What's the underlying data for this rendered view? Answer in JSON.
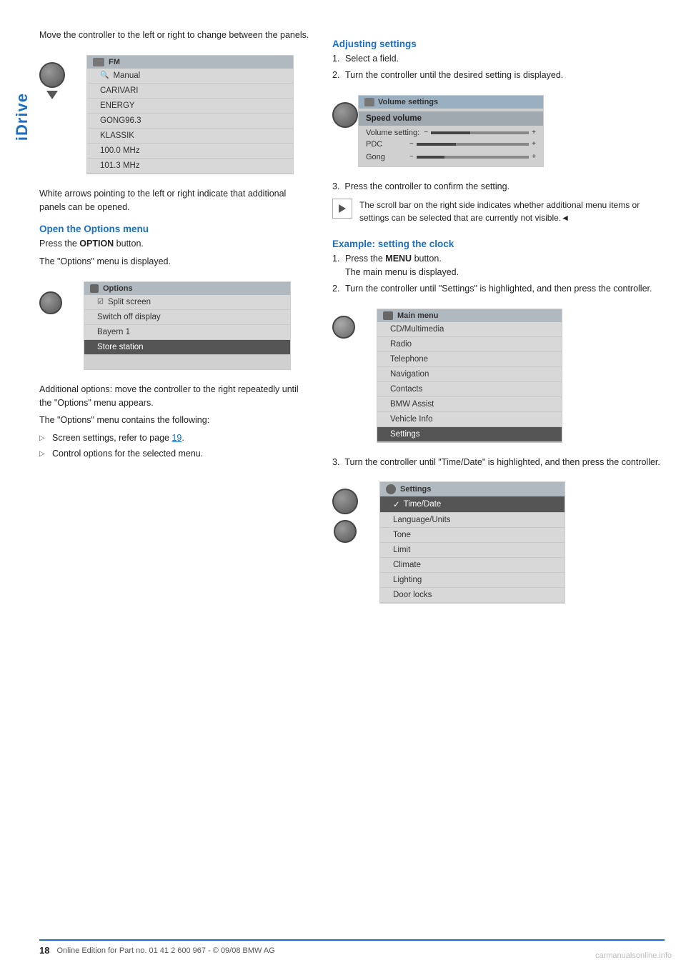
{
  "sidebar": {
    "label": "iDrive"
  },
  "left_col": {
    "intro_text": "Move the controller to the left or right to change between the panels.",
    "fm_screen": {
      "title": "FM",
      "icon": "radio-icon",
      "rows": [
        {
          "text": "Manual",
          "type": "manual"
        },
        {
          "text": "CARIVARI",
          "type": "normal"
        },
        {
          "text": "ENERGY",
          "type": "normal"
        },
        {
          "text": "GONG96.3",
          "type": "normal"
        },
        {
          "text": "KLASSIK",
          "type": "normal"
        },
        {
          "text": "100.0 MHz",
          "type": "normal"
        },
        {
          "text": "101.3 MHz",
          "type": "normal"
        }
      ]
    },
    "white_arrows_text": "White arrows pointing to the left or right indicate that additional panels can be opened.",
    "open_options_heading": "Open the Options menu",
    "open_options_p1": "Press the OPTION button.",
    "open_options_p2": "The \"Options\" menu is displayed.",
    "options_screen": {
      "title": "Options",
      "rows": [
        {
          "text": "Split screen",
          "type": "checked"
        },
        {
          "text": "Switch off display",
          "type": "normal"
        },
        {
          "text": "Bayern 1",
          "type": "normal"
        },
        {
          "text": "Store station",
          "type": "highlighted"
        }
      ]
    },
    "additional_text": "Additional options: move the controller to the right repeatedly until the \"Options\" menu appears.",
    "contains_text": "The \"Options\" menu contains the following:",
    "bullets": [
      {
        "text": "Screen settings, refer to page 19."
      },
      {
        "text": "Control options for the selected menu."
      }
    ],
    "page19_link": "19"
  },
  "right_col": {
    "adjusting_heading": "Adjusting settings",
    "adjusting_steps": [
      {
        "num": "1.",
        "text": "Select a field."
      },
      {
        "num": "2.",
        "text": "Turn the controller until the desired setting is displayed."
      }
    ],
    "volume_screen": {
      "title": "Volume settings",
      "icon": "volume-icon",
      "header_row": "Speed volume",
      "rows": [
        {
          "label": "Volume setting:",
          "type": "label-only"
        },
        {
          "label": "PDC",
          "minus": "−",
          "plus": "+",
          "fill": 30,
          "type": "slider"
        },
        {
          "label": "Gong",
          "minus": "−",
          "plus": "+",
          "fill": 20,
          "type": "slider"
        }
      ]
    },
    "step3_text": "Press the controller to confirm the setting.",
    "scroll_note": "The scroll bar on the right side indicates whether additional menu items or settings can be selected that are currently not visible.◄",
    "example_heading": "Example: setting the clock",
    "example_steps": [
      {
        "num": "1.",
        "text": "Press the MENU button.\nThe main menu is displayed."
      },
      {
        "num": "2.",
        "text": "Turn the controller until \"Settings\" is highlighted, and then press the controller."
      }
    ],
    "main_menu_screen": {
      "title": "Main menu",
      "icon": "menu-icon",
      "rows": [
        {
          "text": "CD/Multimedia",
          "type": "normal"
        },
        {
          "text": "Radio",
          "type": "normal"
        },
        {
          "text": "Telephone",
          "type": "normal"
        },
        {
          "text": "Navigation",
          "type": "normal"
        },
        {
          "text": "Contacts",
          "type": "normal"
        },
        {
          "text": "BMW Assist",
          "type": "normal"
        },
        {
          "text": "Vehicle Info",
          "type": "normal"
        },
        {
          "text": "Settings",
          "type": "highlighted"
        }
      ]
    },
    "step3b_text": "Turn the controller until \"Time/Date\" is highlighted, and then press the controller.",
    "settings_screen": {
      "title": "Settings",
      "icon": "settings-icon",
      "rows": [
        {
          "text": "Time/Date",
          "type": "checked-highlight"
        },
        {
          "text": "Language/Units",
          "type": "normal"
        },
        {
          "text": "Tone",
          "type": "normal"
        },
        {
          "text": "Limit",
          "type": "normal"
        },
        {
          "text": "Climate",
          "type": "normal"
        },
        {
          "text": "Lighting",
          "type": "normal"
        },
        {
          "text": "Door locks",
          "type": "normal"
        }
      ]
    }
  },
  "footer": {
    "page_num": "18",
    "copyright": "Online Edition for Part no. 01 41 2 600 967  - © 09/08 BMW AG"
  },
  "watermark": "carmanualsonline.info"
}
